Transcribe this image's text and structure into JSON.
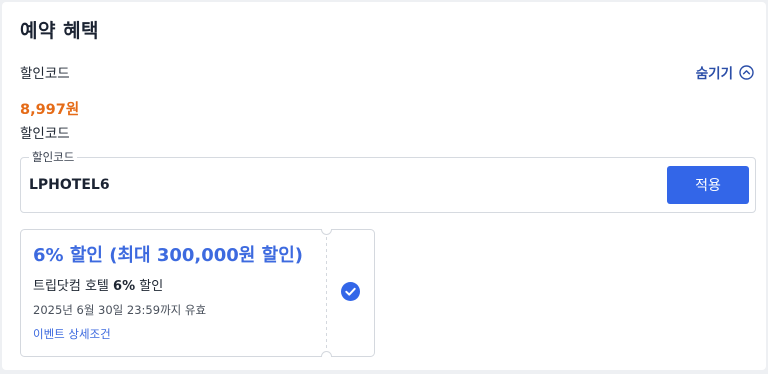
{
  "section": {
    "title": "예약 혜택"
  },
  "discount_code": {
    "label": "할인코드",
    "toggle_label": "숨기기",
    "amount": "8,997원",
    "amount_label": "할인코드",
    "field_label": "할인코드",
    "value": "LPHOTEL6",
    "apply_label": "적용"
  },
  "coupon": {
    "title": "6% 할인 (최대 300,000원 할인)",
    "desc_prefix": "트립닷컴 호텔 ",
    "desc_bold": "6%",
    "desc_suffix": " 할인",
    "validity": "2025년 6월 30일 23:59까지 유효",
    "link": "이벤트 상세조건",
    "selected": true
  },
  "colors": {
    "accent": "#3366e8",
    "amount": "#e56b17",
    "coupon_title": "#3d6adf",
    "toggle": "#2b4ea8"
  },
  "icons": {
    "toggle": "chevron-up-circle-icon",
    "check": "check-circle-icon"
  }
}
